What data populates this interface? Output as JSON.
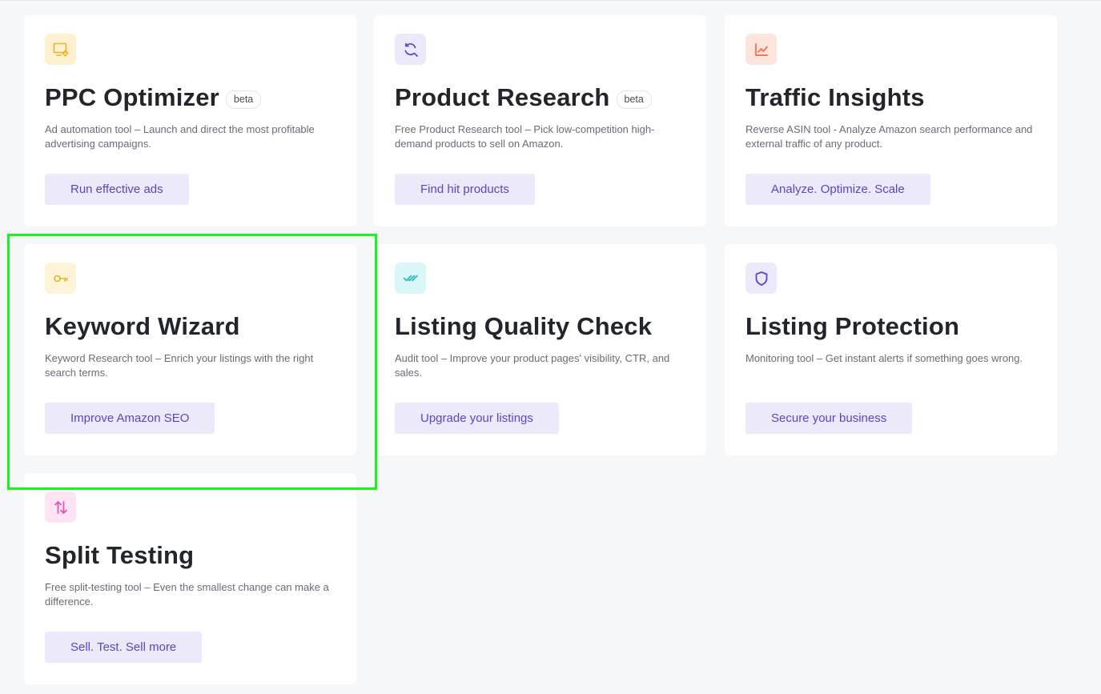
{
  "cards": [
    {
      "title": "PPC Optimizer",
      "badge": "beta",
      "description": "Ad automation tool – Launch and direct the most profitable advertising campaigns.",
      "button": "Run effective ads",
      "icon": "monitor-gear-icon",
      "icon_bg": "#fdf1cf",
      "icon_color": "#e7b42a"
    },
    {
      "title": "Product Research",
      "badge": "beta",
      "description": "Free Product Research tool – Pick low-competition high-demand products to sell on Amazon.",
      "button": "Find hit products",
      "icon": "refresh-search-icon",
      "icon_bg": "#ece9fb",
      "icon_color": "#5b45c7"
    },
    {
      "title": "Traffic Insights",
      "description": "Reverse ASIN tool - Analyze Amazon search performance and external traffic of any product.",
      "button": "Analyze. Optimize. Scale",
      "icon": "trend-chart-icon",
      "icon_bg": "#fde4dc",
      "icon_color": "#f06a45"
    },
    {
      "title": "Keyword Wizard",
      "description": "Keyword Research tool – Enrich your listings with the right search terms.",
      "button": "Improve Amazon SEO",
      "icon": "key-icon",
      "icon_bg": "#fdf3d6",
      "icon_color": "#e7b42a"
    },
    {
      "title": "Listing Quality Check",
      "description": "Audit tool – Improve your product pages' visibility, CTR, and sales.",
      "button": "Upgrade your listings",
      "icon": "double-check-icon",
      "icon_bg": "#daf6f6",
      "icon_color": "#2bb8c0"
    },
    {
      "title": "Listing Protection",
      "description": "Monitoring tool – Get instant alerts if something goes wrong.",
      "button": "Secure your business",
      "icon": "shield-icon",
      "icon_bg": "#ece9fb",
      "icon_color": "#5b45c7"
    },
    {
      "title": "Split Testing",
      "description": "Free split-testing tool – Even the smallest change can make a difference.",
      "button": "Sell. Test. Sell more",
      "icon": "up-down-arrows-icon",
      "icon_bg": "#fde3f4",
      "icon_color": "#e14eb2"
    }
  ],
  "highlight_color": "#19f41c"
}
